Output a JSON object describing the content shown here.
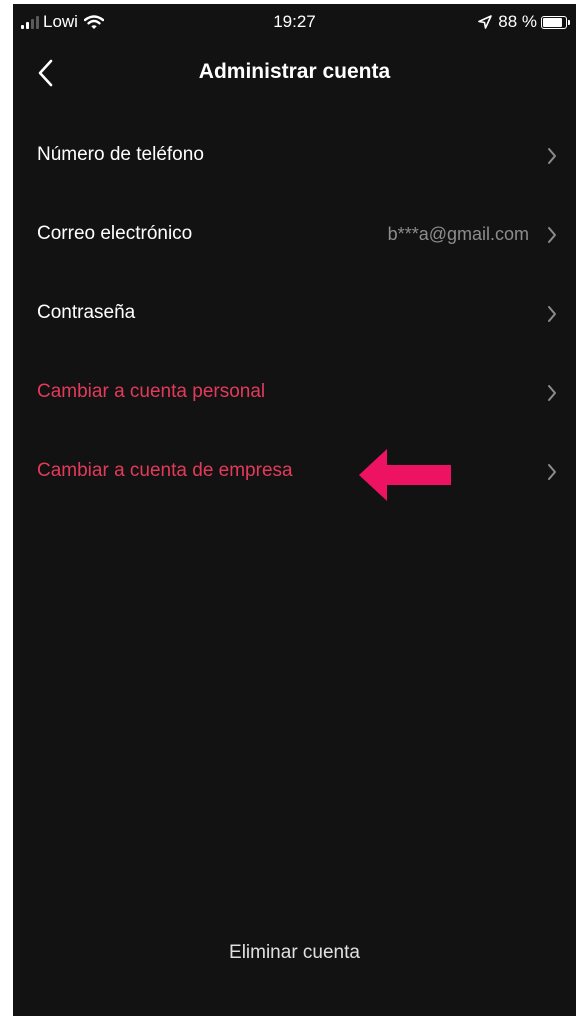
{
  "status_bar": {
    "carrier": "Lowi",
    "time": "19:27",
    "battery": "88 %",
    "battery_level": 0.88,
    "icons": [
      "signal-icon",
      "wifi-icon",
      "location-icon",
      "battery-icon"
    ]
  },
  "header": {
    "title": "Administrar cuenta",
    "back_icon": "chevron-left-icon"
  },
  "settings": {
    "items": [
      {
        "label": "Número de teléfono",
        "value": "",
        "style": "normal"
      },
      {
        "label": "Correo electrónico",
        "value": "b***a@gmail.com",
        "style": "normal"
      },
      {
        "label": "Contraseña",
        "value": "",
        "style": "normal"
      },
      {
        "label": "Cambiar a cuenta personal",
        "value": "",
        "style": "danger"
      },
      {
        "label": "Cambiar a cuenta de empresa",
        "value": "",
        "style": "danger"
      }
    ]
  },
  "footer": {
    "delete_label": "Eliminar cuenta"
  },
  "colors": {
    "background": "#121212",
    "text": "#ffffff",
    "secondary_text": "#8c8c8c",
    "danger_text": "#e33a5b",
    "annotation_arrow": "#ee1263"
  }
}
